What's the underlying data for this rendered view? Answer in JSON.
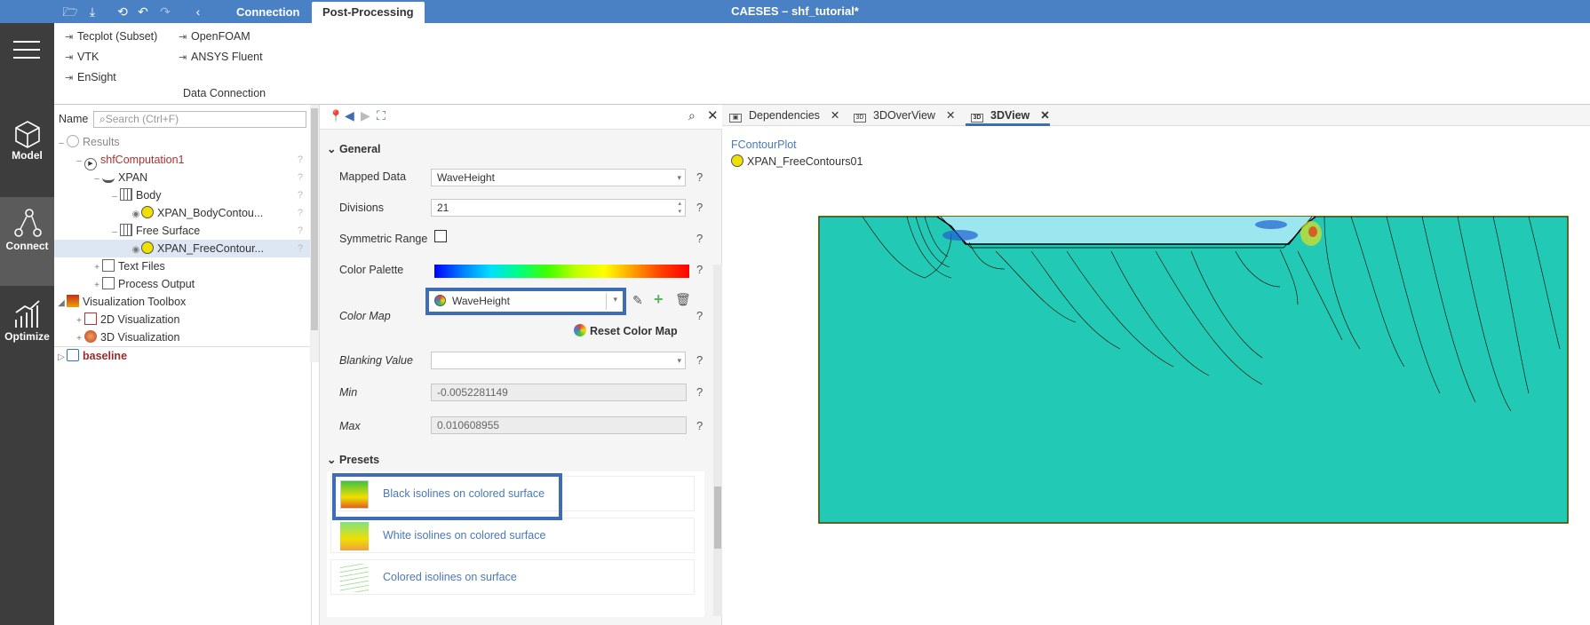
{
  "toolbar": {
    "icons": [
      "open-folder-icon",
      "save-icon",
      "history-icon",
      "undo-icon",
      "redo-icon",
      "back-icon"
    ],
    "tabs": [
      "Connection",
      "Post-Processing"
    ],
    "title": "CAESES – shf_tutorial*"
  },
  "leftnav": {
    "items": [
      {
        "label": "Model",
        "icon": "cube-icon"
      },
      {
        "label": "Connect",
        "icon": "connect-icon"
      },
      {
        "label": "Optimize",
        "icon": "chart-icon"
      }
    ]
  },
  "ribbon": {
    "items": [
      "Tecplot (Subset)",
      "OpenFOAM",
      "VTK",
      "ANSYS Fluent",
      "EnSight"
    ],
    "group_label": "Data Connection"
  },
  "tree": {
    "name_label": "Name",
    "search_placeholder": "Search (Ctrl+F)",
    "nodes": [
      {
        "label": "Results",
        "exp": "–"
      },
      {
        "label": "shfComputation1",
        "exp": "–"
      },
      {
        "label": "XPAN",
        "exp": "–"
      },
      {
        "label": "Body",
        "exp": "–"
      },
      {
        "label": "XPAN_BodyContou...",
        "exp": ""
      },
      {
        "label": "Free Surface",
        "exp": "–"
      },
      {
        "label": "XPAN_FreeContour...",
        "exp": ""
      },
      {
        "label": "Text Files",
        "exp": "+"
      },
      {
        "label": "Process Output",
        "exp": "+"
      },
      {
        "label": "Visualization Toolbox",
        "exp": "◢"
      },
      {
        "label": "2D Visualization",
        "exp": "+"
      },
      {
        "label": "3D Visualization",
        "exp": "+"
      },
      {
        "label": "baseline",
        "exp": "▷"
      }
    ]
  },
  "props": {
    "general_header": "General",
    "mapped_data_label": "Mapped Data",
    "mapped_data_value": "WaveHeight",
    "divisions_label": "Divisions",
    "divisions_value": "21",
    "symmetric_label": "Symmetric Range",
    "palette_label": "Color Palette",
    "colormap_label": "Color Map",
    "colormap_value": "WaveHeight",
    "reset_label": "Reset Color Map",
    "blanking_label": "Blanking Value",
    "blanking_value": "",
    "min_label": "Min",
    "min_value": "-0.0052281149",
    "max_label": "Max",
    "max_value": "0.010608955",
    "qmark": "?",
    "presets_header": "Presets",
    "presets": [
      "Black isolines on colored surface",
      "White isolines on colored surface",
      "Colored isolines on surface"
    ]
  },
  "view": {
    "tabs": [
      "Dependencies",
      "3DOverView",
      "3DView"
    ],
    "active_tab": "3DView",
    "contour_header": "FContourPlot",
    "contour_item": "XPAN_FreeContours01",
    "colors": {
      "surface": "#1ec8b8",
      "frame": "#d4a400"
    }
  }
}
